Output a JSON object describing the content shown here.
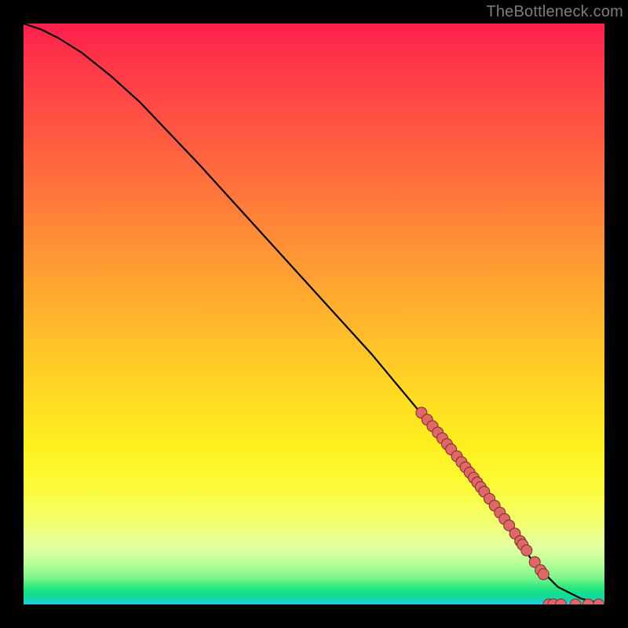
{
  "attribution": "TheBottleneck.com",
  "colors": {
    "frame": "#000000",
    "curve": "#000000",
    "marker_fill": "#e06767",
    "marker_stroke": "#7a2e2e"
  },
  "chart_data": {
    "type": "line",
    "title": "",
    "xlabel": "",
    "ylabel": "",
    "xlim": [
      0,
      100
    ],
    "ylim": [
      0,
      100
    ],
    "curve": {
      "x": [
        0,
        3,
        6,
        10,
        15,
        20,
        30,
        40,
        50,
        60,
        70,
        76,
        80,
        84,
        88,
        92,
        96,
        100
      ],
      "y": [
        100,
        99,
        97.5,
        95,
        91,
        86.5,
        76,
        65,
        54,
        43,
        31,
        24,
        18,
        12.5,
        7,
        3,
        1,
        0
      ]
    },
    "markers": {
      "x": [
        68.5,
        69.5,
        70.4,
        71.3,
        72.1,
        72.9,
        73.6,
        74.6,
        75.4,
        76.1,
        76.8,
        77.5,
        78.1,
        78.7,
        79.3,
        80.2,
        81.1,
        82.0,
        82.8,
        83.6,
        84.6,
        85.5,
        85.9,
        86.6,
        88.0,
        89.0,
        89.5,
        90.4,
        91.2,
        92.5,
        95.0,
        97.2,
        99.0
      ],
      "y": [
        33.0,
        31.8,
        30.7,
        29.6,
        28.6,
        27.6,
        26.7,
        25.5,
        24.5,
        23.6,
        22.7,
        21.8,
        21.0,
        20.2,
        19.4,
        18.2,
        17.0,
        15.8,
        14.7,
        13.6,
        12.2,
        10.9,
        10.3,
        9.3,
        7.3,
        5.9,
        5.2,
        0.0,
        0.0,
        0.0,
        0.0,
        0.0,
        0.0
      ]
    }
  }
}
